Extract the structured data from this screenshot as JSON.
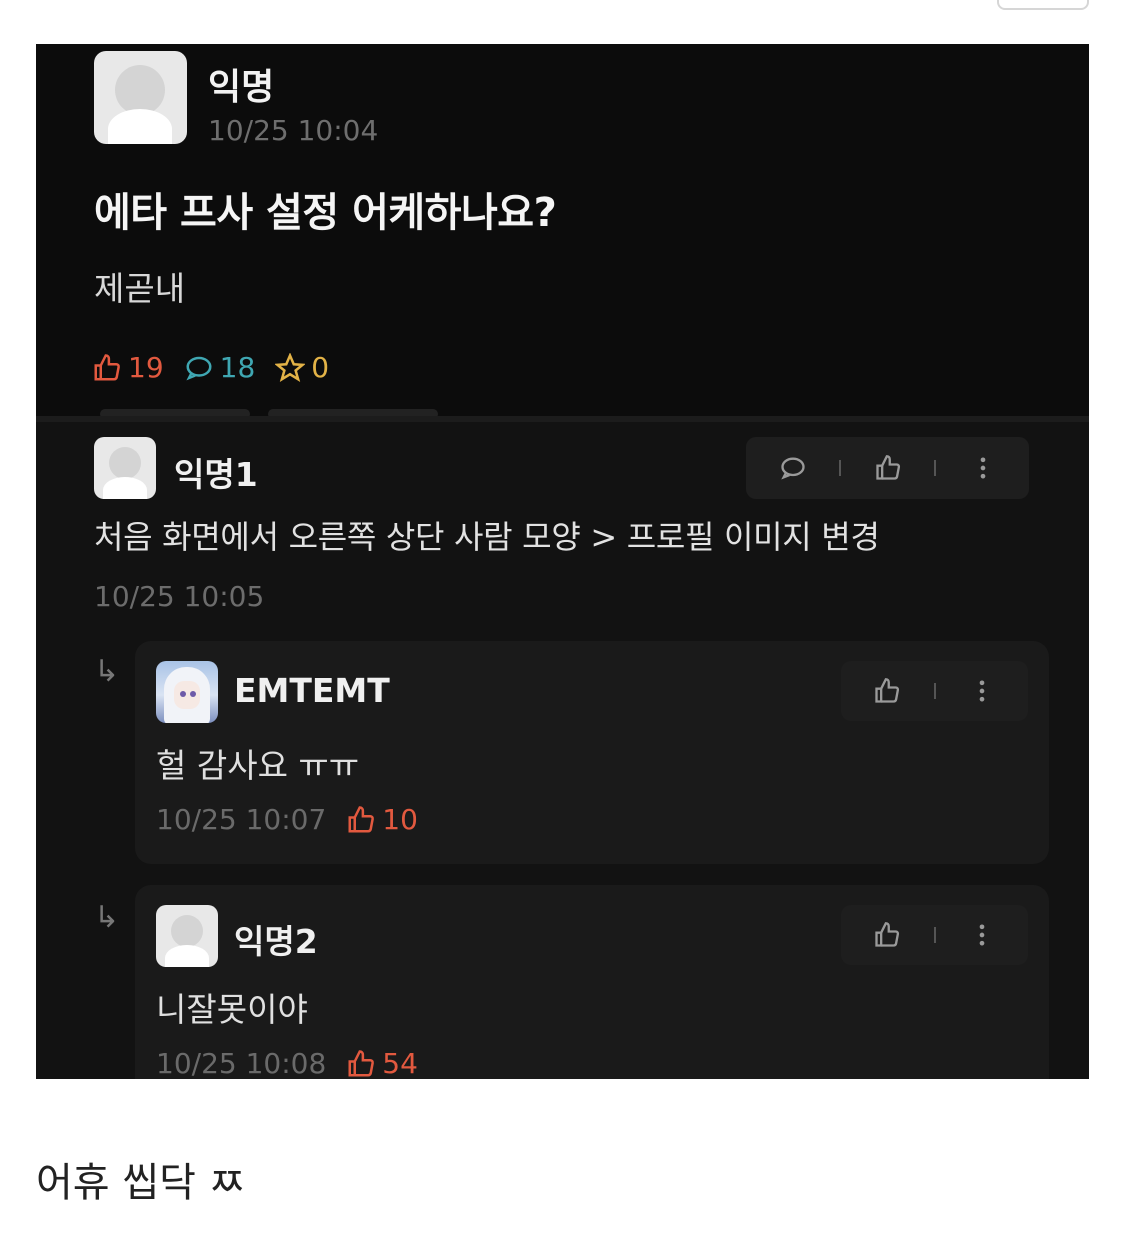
{
  "post": {
    "author": "익명",
    "time": "10/25 10:04",
    "title": "에타 프사 설정 어케하나요?",
    "body": "제곧내",
    "likes": "19",
    "comments": "18",
    "scraps": "0"
  },
  "comments": [
    {
      "author": "익명1",
      "text": "처음 화면에서 오른쪽 상단 사람 모양 > 프로필 이미지 변경",
      "time": "10/25 10:05"
    }
  ],
  "replies": [
    {
      "author": "EMTEMT",
      "text": "헐 감사요 ㅠㅠ",
      "time": "10/25 10:07",
      "likes": "10"
    },
    {
      "author": "익명2",
      "text": "니잘못이야",
      "time": "10/25 10:08",
      "likes": "54"
    }
  ],
  "caption": "어휴 씹닥 ㅉ",
  "colors": {
    "like": "#e2593f",
    "comment": "#3fa7b2",
    "scrap": "#e3b347",
    "background": "#0f0f0f"
  }
}
